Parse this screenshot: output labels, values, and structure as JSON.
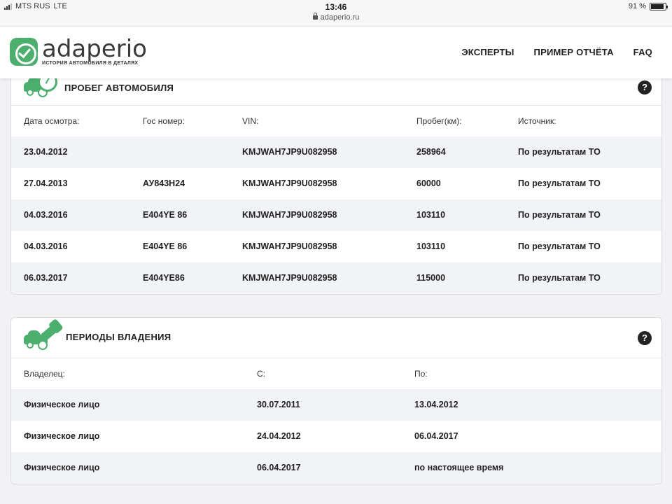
{
  "status_bar": {
    "carrier": "MTS RUS",
    "network": "LTE",
    "time": "13:46",
    "url": "adaperio.ru",
    "battery": "91 %",
    "battery_level": 0.91
  },
  "header": {
    "logo_name": "adaperio",
    "logo_tagline": "ИСТОРИЯ АВТОМОБИЛЯ В ДЕТАЛЯХ",
    "nav": [
      "ЭКСПЕРТЫ",
      "ПРИМЕР ОТЧЁТА",
      "FAQ"
    ]
  },
  "mileage": {
    "title": "ПРОБЕГ АВТОМОБИЛЯ",
    "help": "?",
    "columns": [
      "Дата осмотра:",
      "Гос номер:",
      "VIN:",
      "Пробег(км):",
      "Источник:"
    ],
    "rows": [
      [
        "23.04.2012",
        "",
        "KMJWAH7JP9U082958",
        "258964",
        "По результатам ТО"
      ],
      [
        "27.04.2013",
        "АУ843Н24",
        "KMJWAH7JP9U082958",
        "60000",
        "По результатам ТО"
      ],
      [
        "04.03.2016",
        "Е404YE 86",
        "KMJWAH7JP9U082958",
        "103110",
        "По результатам ТО"
      ],
      [
        "04.03.2016",
        "Е404YE 86",
        "KMJWAH7JP9U082958",
        "103110",
        "По результатам ТО"
      ],
      [
        "06.03.2017",
        "Е404YE86",
        "KMJWAH7JP9U082958",
        "115000",
        "По результатам ТО"
      ]
    ]
  },
  "ownership": {
    "title": "ПЕРИОДЫ ВЛАДЕНИЯ",
    "help": "?",
    "columns": [
      "Владелец:",
      "С:",
      "По:"
    ],
    "rows": [
      [
        "Физическое лицо",
        "30.07.2011",
        "13.04.2012"
      ],
      [
        "Физическое лицо",
        "24.04.2012",
        "06.04.2017"
      ],
      [
        "Физическое лицо",
        "06.04.2017",
        "по настоящее время"
      ]
    ]
  },
  "colors": {
    "brand_green": "#4caf6e",
    "row_alt": "#f2f3f6"
  }
}
